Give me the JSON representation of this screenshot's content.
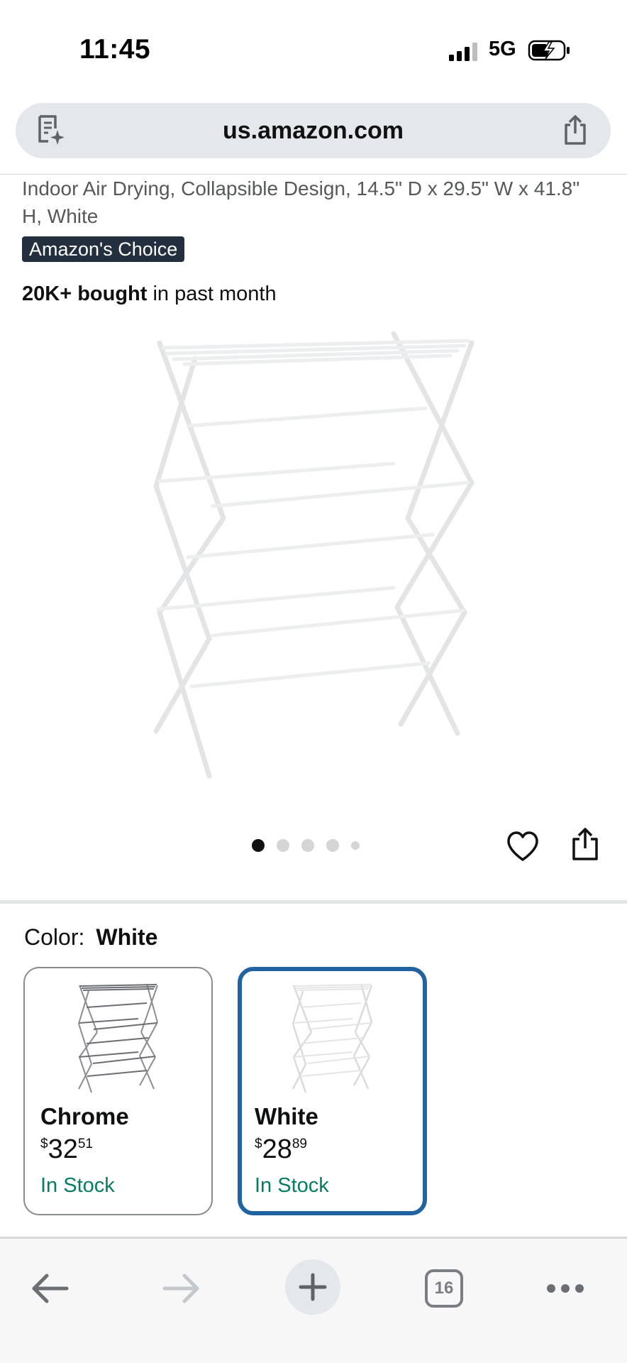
{
  "status_bar": {
    "time": "11:45",
    "network": "5G"
  },
  "browser": {
    "url": "us.amazon.com",
    "tab_count": "16"
  },
  "product": {
    "title": "Indoor Air Drying, Collapsible Design, 14.5\" D x 29.5\" W x 41.8\" H, White",
    "badge": "Amazon's Choice",
    "bought_bold": "20K+ bought",
    "bought_rest": " in past month",
    "image_count": 5,
    "active_image_index": 0
  },
  "color": {
    "label": "Color:",
    "selected": "White",
    "options": [
      {
        "name": "Chrome",
        "currency": "$",
        "price_whole": "32",
        "price_fraction": "51",
        "stock": "In Stock",
        "selected": false
      },
      {
        "name": "White",
        "currency": "$",
        "price_whole": "28",
        "price_fraction": "89",
        "stock": "In Stock",
        "selected": true
      }
    ]
  },
  "colors": {
    "badge_bg": "#232f3e",
    "in_stock": "#067d62",
    "selected_border": "#2162a1",
    "url_bar": "#e4e7eb"
  },
  "icons": [
    "signal-icon",
    "battery-icon",
    "page-summary-icon",
    "share-icon",
    "heart-icon",
    "back-icon",
    "forward-icon",
    "plus-icon",
    "more-icon"
  ]
}
